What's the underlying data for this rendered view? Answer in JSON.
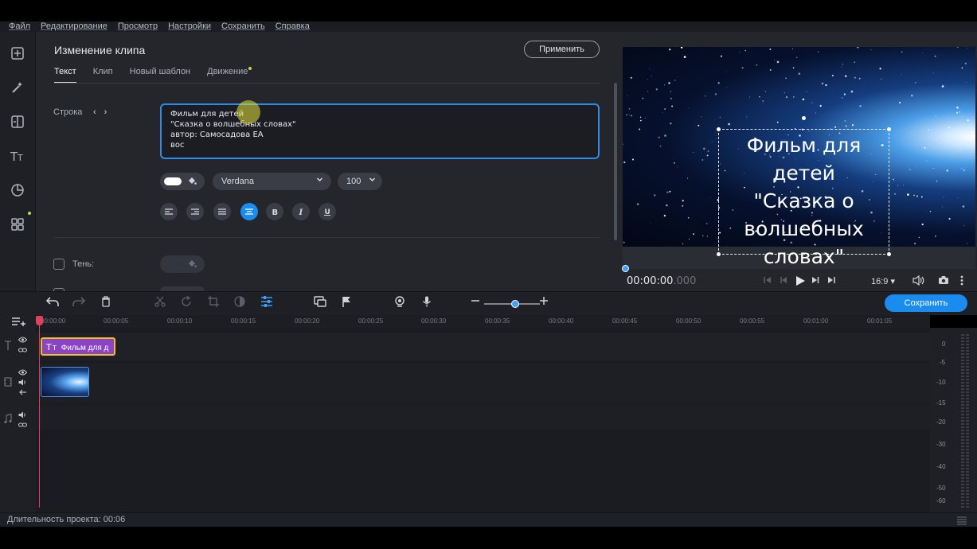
{
  "menu": [
    "Файл",
    "Редактирование",
    "Просмотр",
    "Настройки",
    "Сохранить",
    "Справка"
  ],
  "editor": {
    "title": "Изменение клипа",
    "apply_label": "Применить",
    "tabs": [
      "Текст",
      "Клип",
      "Новый шаблон",
      "Движение"
    ],
    "row_label": "Строка",
    "row_prev": "‹",
    "row_next": "›",
    "text_value": "Фильм для детей\n\"Сказка о волшебных словах\"\nавтор: Самосадова ЕА\nвос",
    "font": "Verdana",
    "size": "100",
    "shadow_label": "Тень:"
  },
  "preview": {
    "overlay_text": "Фильм для\nдетей\n\"Сказка о\nволшебных\nсловах\"",
    "timecode": "00:00:00",
    "timecode_ms": ".000",
    "aspect": "16:9 ▾"
  },
  "toolbar": {
    "save_label": "Сохранить"
  },
  "ruler": [
    "00:00:00",
    "00:00:05",
    "00:00:10",
    "00:00:15",
    "00:00:20",
    "00:00:25",
    "00:00:30",
    "00:00:35",
    "00:00:40",
    "00:00:45",
    "00:00:50",
    "00:00:55",
    "00:01:00",
    "00:01:05"
  ],
  "timeline": {
    "text_clip_label": "Фильм для д"
  },
  "vu_labels": [
    "0",
    "-5",
    "-10",
    "-15",
    "-20",
    "-30",
    "-40",
    "-50",
    "-60"
  ],
  "status": "Длительность проекта: 00:06",
  "colors": {
    "accent": "#1a8cf0",
    "text_clip": "#8c44c6",
    "clip_border": "#f0c020",
    "playhead": "#e0415a"
  }
}
